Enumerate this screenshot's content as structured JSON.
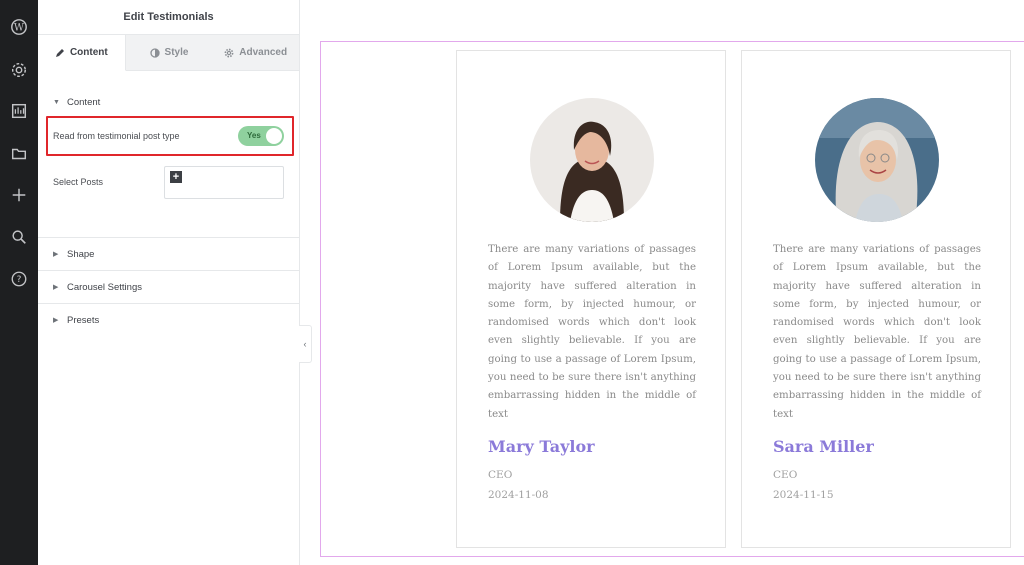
{
  "rail": {
    "icons": [
      "wordpress-icon",
      "settings-icon",
      "structure-icon",
      "folder-icon",
      "plus-icon",
      "search-icon",
      "help-icon"
    ]
  },
  "panel": {
    "title": "Edit Testimonials",
    "tabs": [
      {
        "label": "Content",
        "icon": "pencil-icon",
        "active": true
      },
      {
        "label": "Style",
        "icon": "half-circle-icon",
        "active": false
      },
      {
        "label": "Advanced",
        "icon": "gear-icon",
        "active": false
      }
    ],
    "content_section": {
      "title": "Content",
      "read_from_post_type": {
        "label": "Read from testimonial post type",
        "value": "Yes",
        "enabled": true
      },
      "select_posts": {
        "label": "Select Posts"
      }
    },
    "sections": [
      "Shape",
      "Carousel Settings",
      "Presets"
    ]
  },
  "colors": {
    "accent_name": "#8b7ad9",
    "toggle_on": "#8fd19e",
    "highlight": "#e0262b"
  },
  "testimonials": [
    {
      "quote": "There are many variations of passages of Lorem Ipsum available, but the majority have suffered alteration in some form, by injected humour, or randomised words which don't look even slightly believable. If you are going to use a passage of Lorem Ipsum, you need to be sure there isn't anything embarrassing hidden in the middle of text",
      "name": "Mary Taylor",
      "role": "CEO",
      "date": "2024-11-08"
    },
    {
      "quote": "There are many variations of passages of Lorem Ipsum available, but the majority have suffered alteration in some form, by injected humour, or randomised words which don't look even slightly believable. If you are going to use a passage of Lorem Ipsum, you need to be sure there isn't anything embarrassing hidden in the middle of text",
      "name": "Sara Miller",
      "role": "CEO",
      "date": "2024-11-15"
    }
  ]
}
